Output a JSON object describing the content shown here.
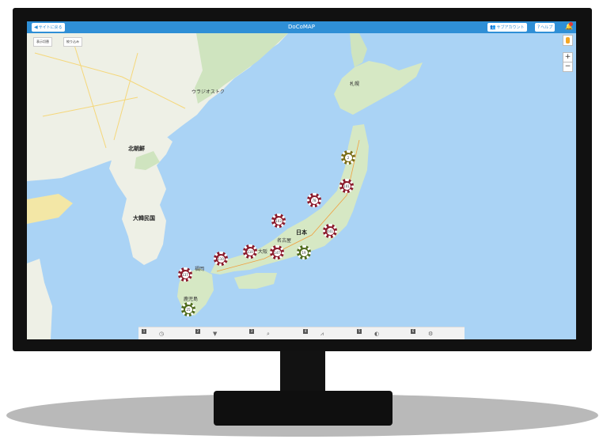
{
  "app": {
    "title": "DoCoMAP"
  },
  "topbar": {
    "back_label": "サイトに戻る",
    "sub_account_label": "サブアカウント",
    "help_label": "ヘルプ"
  },
  "filters": {
    "display_toggle": "表示切替",
    "filter_tab": "絞り込み"
  },
  "zoom": {
    "in": "+",
    "out": "−"
  },
  "map_labels": {
    "north_korea": "北朝鮮",
    "south_korea": "大韓民国",
    "japan": "日本",
    "vladivostok": "ウラジオストク",
    "sapporo": "札幌",
    "nagoya": "名古屋",
    "osaka": "大阪",
    "fukuoka": "福岡",
    "kagoshima": "鹿児島"
  },
  "markers": [
    {
      "label": "2",
      "color": "#7a6d17"
    },
    {
      "label": "101",
      "color": "#8b1a2b"
    },
    {
      "label": "78",
      "color": "#8b1a2b"
    },
    {
      "label": "103",
      "color": "#8b1a2b"
    },
    {
      "label": "441",
      "color": "#8b1a2b"
    },
    {
      "label": "110",
      "color": "#8b1a2b"
    },
    {
      "label": "147",
      "color": "#8b1a2b"
    },
    {
      "label": "110",
      "color": "#8b1a2b"
    },
    {
      "label": "19",
      "color": "#4f6b1c"
    },
    {
      "label": "137",
      "color": "#8b1a2b"
    },
    {
      "label": "25",
      "color": "#4f6b1c"
    }
  ],
  "bottombar": {
    "items": [
      {
        "num": "1",
        "icon": "clock-icon",
        "glyph": "◷"
      },
      {
        "num": "2",
        "icon": "filter-icon",
        "glyph": "▼"
      },
      {
        "num": "3",
        "icon": "search-icon",
        "glyph": "⌕"
      },
      {
        "num": "4",
        "icon": "chart-icon",
        "glyph": "⩘"
      },
      {
        "num": "5",
        "icon": "contrast-icon",
        "glyph": "◐"
      },
      {
        "num": "6",
        "icon": "gear-icon",
        "glyph": "⚙"
      }
    ]
  }
}
